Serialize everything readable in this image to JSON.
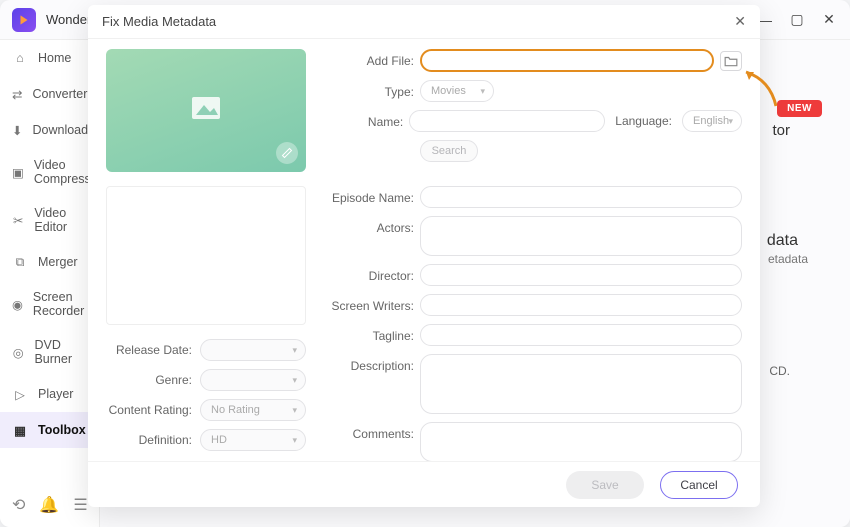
{
  "app": {
    "title": "Wonder"
  },
  "win": {
    "min": "—",
    "max": "▢",
    "close": "✕"
  },
  "sidebar": {
    "items": [
      {
        "label": "Home"
      },
      {
        "label": "Converter"
      },
      {
        "label": "Downloader"
      },
      {
        "label": "Video Compressor"
      },
      {
        "label": "Video Editor"
      },
      {
        "label": "Merger"
      },
      {
        "label": "Screen Recorder"
      },
      {
        "label": "DVD Burner"
      },
      {
        "label": "Player"
      },
      {
        "label": "Toolbox"
      }
    ]
  },
  "rhs": {
    "new": "NEW",
    "heading": "tor",
    "sub1": "data",
    "sub2": "etadata",
    "sub3": "CD."
  },
  "modal": {
    "title": "Fix Media Metadata",
    "addfile": "Add File:",
    "type": "Type:",
    "type_value": "Movies",
    "name": "Name:",
    "language": "Language:",
    "language_value": "English",
    "search": "Search",
    "episode": "Episode Name:",
    "actors": "Actors:",
    "director": "Director:",
    "writers": "Screen Writers:",
    "tagline": "Tagline:",
    "description": "Description:",
    "comments": "Comments:",
    "save": "Save",
    "cancel": "Cancel"
  },
  "meta": {
    "release": "Release Date:",
    "genre": "Genre:",
    "rating": "Content Rating:",
    "rating_value": "No Rating",
    "definition": "Definition:",
    "definition_value": "HD"
  }
}
